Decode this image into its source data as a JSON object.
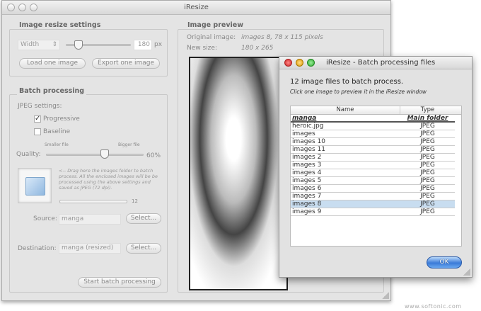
{
  "main_window": {
    "title": "iResize",
    "resize_settings": {
      "title": "Image resize settings",
      "dimension": "Width",
      "size_value": "180",
      "unit": "px",
      "slider_fraction": 0.2,
      "load_button": "Load one image",
      "export_button": "Export one image"
    },
    "batch": {
      "title": "Batch processing",
      "jpeg_settings": "JPEG settings:",
      "progressive": "Progressive",
      "progressive_checked": true,
      "baseline": "Baseline",
      "baseline_checked": false,
      "smaller": "Smaller file",
      "bigger": "Bigger file",
      "quality_label": "Quality:",
      "quality_value": "60%",
      "quality_fraction": 0.6,
      "drop_hint": "<-- Drag here the images folder to batch process. All the enclosed images will be be processed using the above settings and saved as JPEG (72 dpi).",
      "count": "12",
      "source_label": "Source:",
      "source_value": "manga",
      "select_label": "Select...",
      "destination_label": "Destination:",
      "destination_value": "manga (resized)",
      "start_button": "Start batch processing"
    },
    "preview": {
      "title": "Image preview",
      "original_label": "Original image:",
      "original_value": "images 8, 78 x 115 pixels",
      "new_label": "New size:",
      "new_value": "180 x 265"
    }
  },
  "dialog": {
    "title": "iResize - Batch processing files",
    "heading": "12 image files to batch process.",
    "subheading": "Click one image to preview it in the iResize window",
    "columns": [
      "Name",
      "Type"
    ],
    "folder": {
      "name": "manga",
      "type": "Main folder"
    },
    "rows": [
      {
        "name": "heroic.jpg",
        "type": "JPEG"
      },
      {
        "name": "images",
        "type": "JPEG"
      },
      {
        "name": "images 10",
        "type": "JPEG"
      },
      {
        "name": "images 11",
        "type": "JPEG"
      },
      {
        "name": "images 2",
        "type": "JPEG"
      },
      {
        "name": "images 3",
        "type": "JPEG"
      },
      {
        "name": "images 4",
        "type": "JPEG"
      },
      {
        "name": "images 5",
        "type": "JPEG"
      },
      {
        "name": "images 6",
        "type": "JPEG"
      },
      {
        "name": "images 7",
        "type": "JPEG"
      },
      {
        "name": "images 8",
        "type": "JPEG"
      },
      {
        "name": "images 9",
        "type": "JPEG"
      }
    ],
    "selected_index": 10,
    "ok_button": "OK"
  },
  "watermark": "www.softonic.com"
}
